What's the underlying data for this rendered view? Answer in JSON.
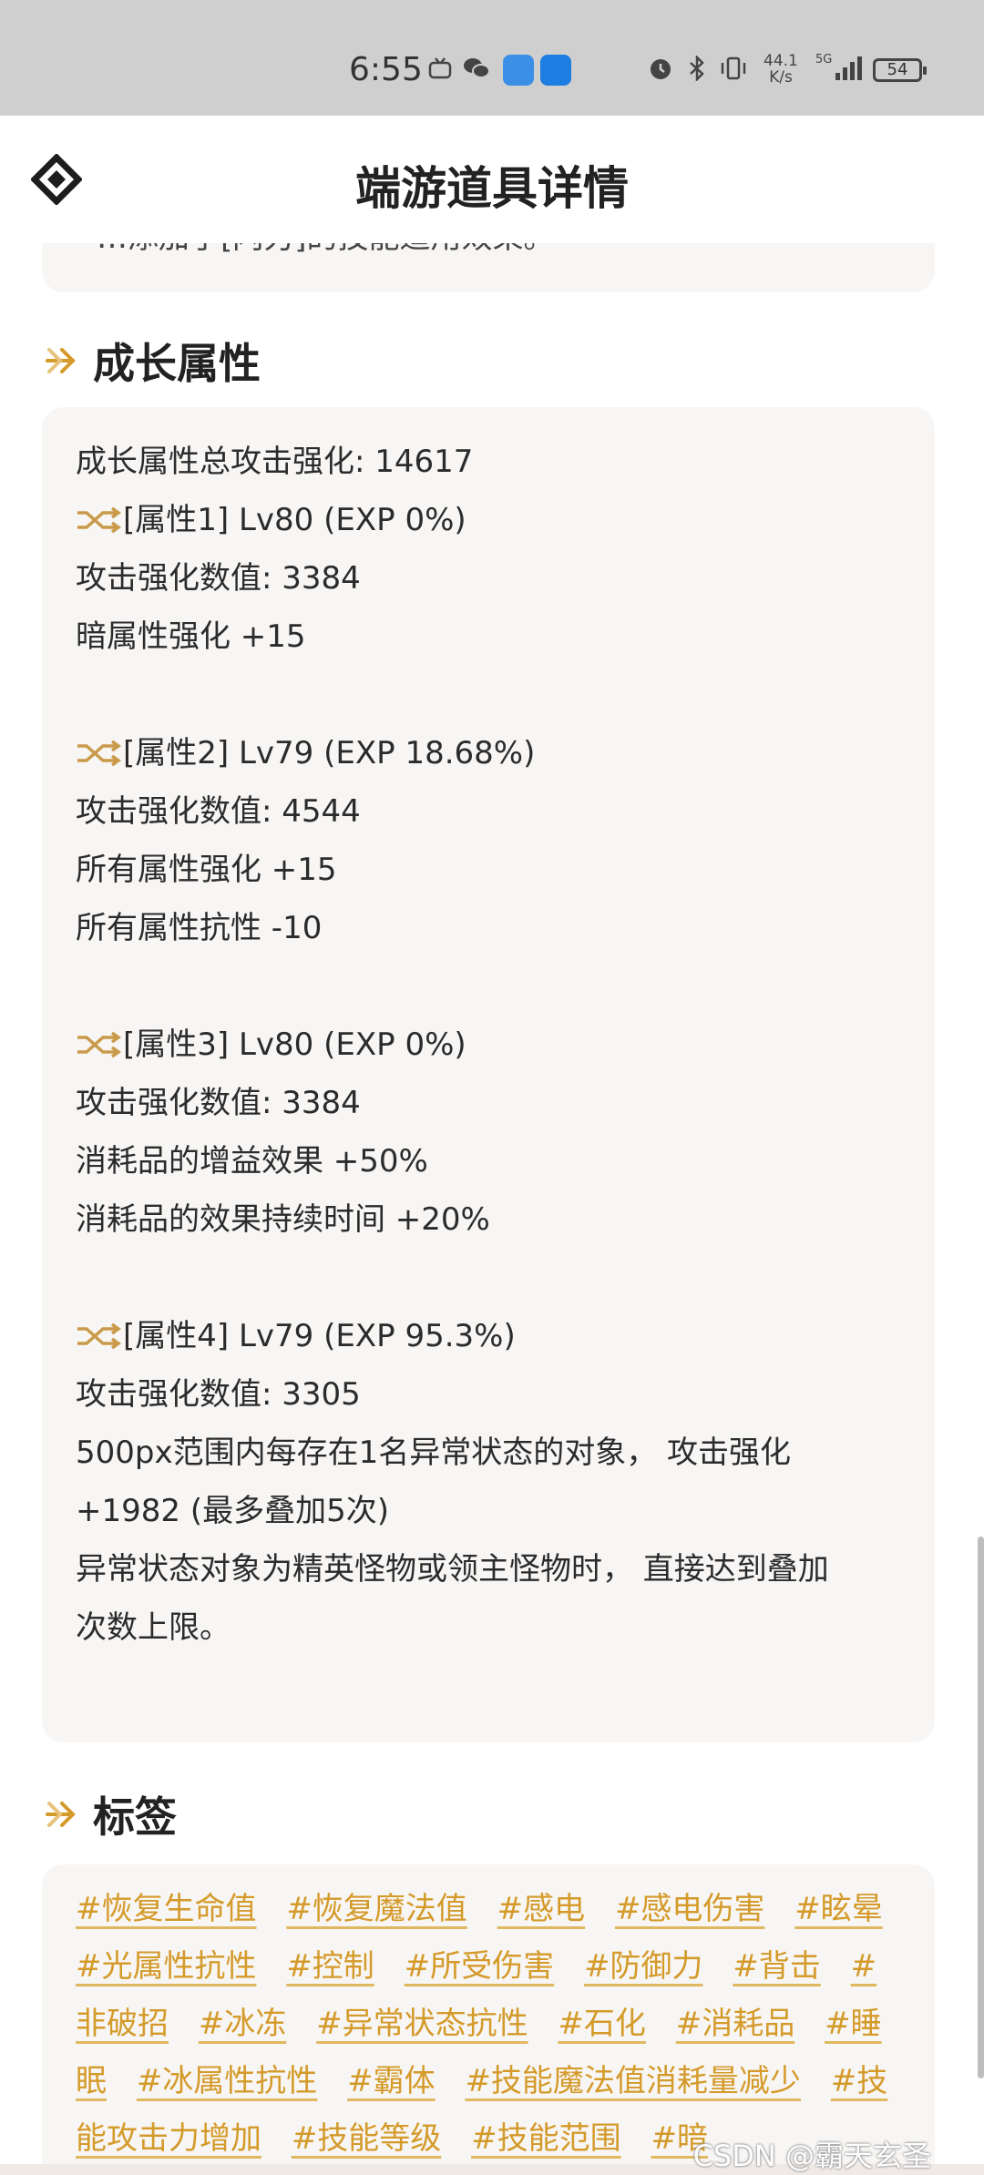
{
  "status": {
    "time": "6:55",
    "net_speed_value": "44.1",
    "net_speed_unit": "K/s",
    "signal_label": "5G",
    "battery": "54"
  },
  "header": {
    "title": "端游道具详情"
  },
  "top_card": {
    "partial_text": "…添加了[闪刃]的技能适用效果。"
  },
  "growth": {
    "section_title": "成长属性",
    "total": "成长属性总攻击强化: 14617",
    "blocks": [
      {
        "head": "[属性1] Lv80 (EXP 0%)",
        "lines": [
          "攻击强化数值:  3384",
          "暗属性强化 +15"
        ]
      },
      {
        "head": "[属性2] Lv79 (EXP 18.68%)",
        "lines": [
          "攻击强化数值:  4544",
          "所有属性强化 +15",
          "所有属性抗性 -10"
        ]
      },
      {
        "head": "[属性3] Lv80 (EXP 0%)",
        "lines": [
          "攻击强化数值:  3384",
          "消耗品的增益效果 +50%",
          "消耗品的效果持续时间 +20%"
        ]
      },
      {
        "head": "[属性4] Lv79 (EXP 95.3%)",
        "lines": [
          "攻击强化数值:  3305",
          "500px范围内每存在1名异常状态的对象， 攻击强化",
          "+1982 (最多叠加5次)",
          "异常状态对象为精英怪物或领主怪物时， 直接达到叠加",
          "次数上限。"
        ]
      }
    ]
  },
  "tags": {
    "section_title": "标签",
    "items": [
      "#恢复生命值",
      "#恢复魔法值",
      "#感电",
      "#感电伤害",
      "#眩晕",
      "#光属性抗性",
      "#控制",
      "#所受伤害",
      "#防御力",
      "#背击",
      "#非破招",
      "#冰冻",
      "#异常状态抗性",
      "#石化",
      "#消耗品",
      "#睡眠",
      "#冰属性抗性",
      "#霸体",
      "#技能魔法值消耗量减少",
      "#技能攻击力增加",
      "#技能等级",
      "#技能范围",
      "#暗"
    ]
  },
  "watermark": "CSDN @霸天玄圣",
  "colors": {
    "accent": "#d49a2a",
    "card_bg": "#f8f6f4",
    "status_bg": "#cfcfcf"
  }
}
